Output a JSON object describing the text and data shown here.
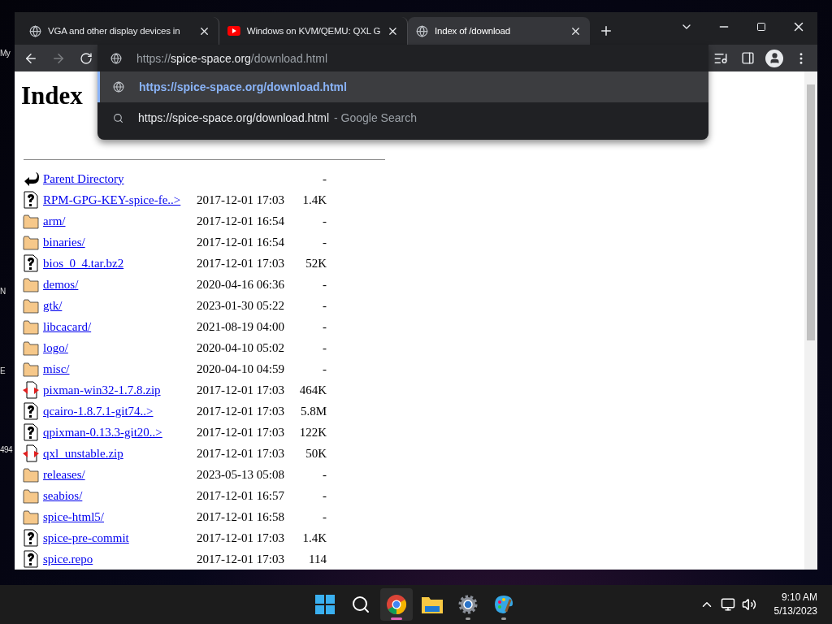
{
  "desktop": {
    "icon_labels": [
      "My",
      "N",
      "E",
      "494"
    ]
  },
  "browser": {
    "tabs": [
      {
        "title": "VGA and other display devices in",
        "kind": "page",
        "selected": false
      },
      {
        "title": "Windows on KVM/QEMU: QXL G",
        "kind": "video",
        "selected": false
      },
      {
        "title": "Index of /download",
        "kind": "page",
        "selected": true
      }
    ],
    "address_bar": {
      "scheme": "https://",
      "host": "spice-space.org",
      "path": "/download.html"
    },
    "suggestions": [
      {
        "kind": "url",
        "text": "https://spice-space.org/download.html",
        "selected": true
      },
      {
        "kind": "search",
        "text": "https://spice-space.org/download.html",
        "hint": "- Google Search",
        "selected": false
      }
    ]
  },
  "page": {
    "heading": "Index",
    "rows": [
      {
        "kind": "parent",
        "name": "Parent Directory",
        "modified": "",
        "size": "-"
      },
      {
        "kind": "unknown",
        "name": "RPM-GPG-KEY-spice-fe..>",
        "modified": "2017-12-01 17:03",
        "size": "1.4K"
      },
      {
        "kind": "folder",
        "name": "arm/",
        "modified": "2017-12-01 16:54",
        "size": "-"
      },
      {
        "kind": "folder",
        "name": "binaries/",
        "modified": "2017-12-01 16:54",
        "size": "-"
      },
      {
        "kind": "unknown",
        "name": "bios_0_4.tar.bz2",
        "modified": "2017-12-01 17:03",
        "size": "52K"
      },
      {
        "kind": "folder",
        "name": "demos/",
        "modified": "2020-04-16 06:36",
        "size": "-"
      },
      {
        "kind": "folder",
        "name": "gtk/",
        "modified": "2023-01-30 05:22",
        "size": "-"
      },
      {
        "kind": "folder",
        "name": "libcacard/",
        "modified": "2021-08-19 04:00",
        "size": "-"
      },
      {
        "kind": "folder",
        "name": "logo/",
        "modified": "2020-04-10 05:02",
        "size": "-"
      },
      {
        "kind": "folder",
        "name": "misc/",
        "modified": "2020-04-10 04:59",
        "size": "-"
      },
      {
        "kind": "compressed",
        "name": "pixman-win32-1.7.8.zip",
        "modified": "2017-12-01 17:03",
        "size": "464K"
      },
      {
        "kind": "unknown",
        "name": "qcairo-1.8.7.1-git74..>",
        "modified": "2017-12-01 17:03",
        "size": "5.8M"
      },
      {
        "kind": "unknown",
        "name": "qpixman-0.13.3-git20..>",
        "modified": "2017-12-01 17:03",
        "size": "122K"
      },
      {
        "kind": "compressed",
        "name": "qxl_unstable.zip",
        "modified": "2017-12-01 17:03",
        "size": "50K"
      },
      {
        "kind": "folder",
        "name": "releases/",
        "modified": "2023-05-13 05:08",
        "size": "-"
      },
      {
        "kind": "folder",
        "name": "seabios/",
        "modified": "2017-12-01 16:57",
        "size": "-"
      },
      {
        "kind": "folder",
        "name": "spice-html5/",
        "modified": "2017-12-01 16:58",
        "size": "-"
      },
      {
        "kind": "unknown",
        "name": "spice-pre-commit",
        "modified": "2017-12-01 17:03",
        "size": "1.4K"
      },
      {
        "kind": "unknown",
        "name": "spice.repo",
        "modified": "2017-12-01 17:03",
        "size": "114"
      }
    ]
  },
  "taskbar": {
    "apps": [
      {
        "kind": "start",
        "selected": false
      },
      {
        "kind": "search",
        "selected": false
      },
      {
        "kind": "browser",
        "selected": true
      },
      {
        "kind": "files",
        "selected": false
      },
      {
        "kind": "settings",
        "selected": false
      },
      {
        "kind": "paint",
        "selected": false
      }
    ],
    "time": "9:10 AM",
    "date": "5/13/2023"
  }
}
